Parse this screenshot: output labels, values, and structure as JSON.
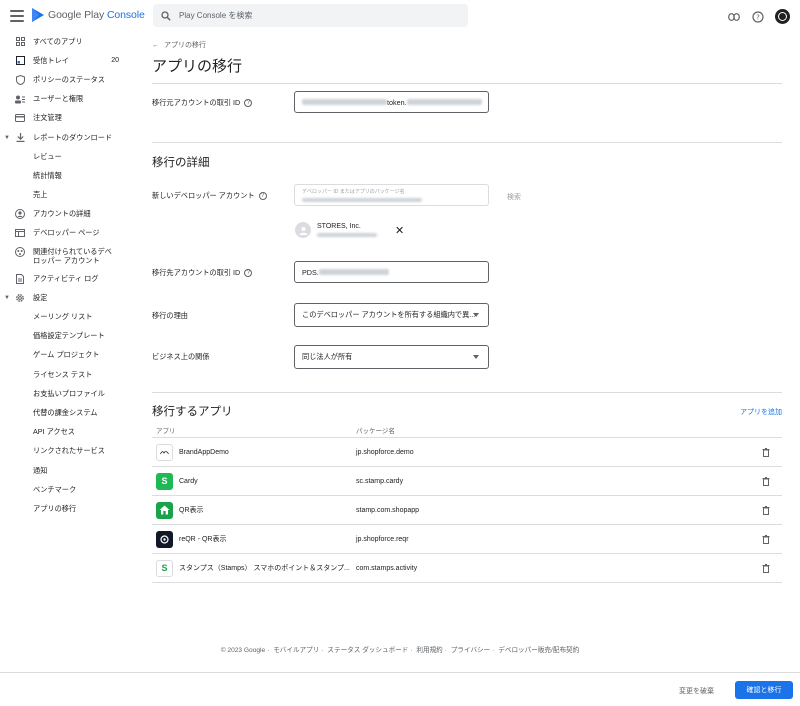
{
  "header": {
    "logo_brand": "Google Play",
    "logo_product": "Console",
    "search_placeholder": "Play Console を検索",
    "icons": [
      "link-icon",
      "help-icon",
      "account-avatar"
    ]
  },
  "sidebar": {
    "items": [
      {
        "label": "すべてのアプリ",
        "icon": "apps-grid-icon"
      },
      {
        "label": "受信トレイ",
        "icon": "inbox-icon",
        "badge": "20"
      },
      {
        "label": "ポリシーのステータス",
        "icon": "shield-icon"
      },
      {
        "label": "ユーザーと権限",
        "icon": "users-icon"
      },
      {
        "label": "注文管理",
        "icon": "card-icon"
      },
      {
        "label": "レポートのダウンロード",
        "icon": "download-icon"
      },
      {
        "label": "レビュー"
      },
      {
        "label": "統計情報"
      },
      {
        "label": "売上"
      },
      {
        "label": "アカウントの詳細",
        "icon": "account-icon"
      },
      {
        "label": "デベロッパー ページ",
        "icon": "page-icon"
      },
      {
        "label": "関連付けられているデベロッパー アカウント",
        "icon": "linked-account-icon"
      },
      {
        "label": "アクティビティ ログ",
        "icon": "log-icon"
      },
      {
        "label": "設定",
        "icon": "gear-icon"
      },
      {
        "label": "メーリング リスト"
      },
      {
        "label": "価格設定テンプレート"
      },
      {
        "label": "ゲーム プロジェクト"
      },
      {
        "label": "ライセンス テスト"
      },
      {
        "label": "お支払いプロファイル"
      },
      {
        "label": "代替の課金システム"
      },
      {
        "label": "API アクセス"
      },
      {
        "label": "リンクされたサービス"
      },
      {
        "label": "通知"
      },
      {
        "label": "ベンチマーク"
      },
      {
        "label": "アプリの移行"
      }
    ]
  },
  "main": {
    "back_label": "アプリの移行",
    "title": "アプリの移行",
    "source_txn_label": "移行元アカウントの取引 ID",
    "source_txn_visible": "token.",
    "details_title": "移行の詳細",
    "new_dev_label": "新しいデベロッパー アカウント",
    "new_dev_placeholder": "デベロッパー ID またはアプリのパッケージ名",
    "search_button": "検索",
    "selected_dev_name": "STORES, Inc.",
    "dest_txn_label": "移行先アカウントの取引 ID",
    "dest_txn_visible": "PDS.",
    "reason_label": "移行の理由",
    "reason_value": "このデベロッパー アカウントを所有する組織内で異...",
    "relationship_label": "ビジネス上の関係",
    "relationship_value": "同じ法人が所有",
    "apps_title": "移行するアプリ",
    "add_app": "アプリを追加",
    "col_app": "アプリ",
    "col_package": "パッケージ名",
    "apps": [
      {
        "name": "BrandAppDemo",
        "package": "jp.shopforce.demo",
        "icon_color": "#ffffff",
        "icon_text": "",
        "icon_border": "#dadce0"
      },
      {
        "name": "Cardy",
        "package": "sc.stamp.cardy",
        "icon_color": "#1db954",
        "icon_text": "S"
      },
      {
        "name": "QR表示",
        "package": "stamp.com.shopapp",
        "icon_color": "#1aa34a",
        "icon_text": "⌂"
      },
      {
        "name": "reQR - QR表示",
        "package": "jp.shopforce.reqr",
        "icon_color": "#111827",
        "icon_text": "◉"
      },
      {
        "name": "スタンプス（Stamps） スマホのポイント＆スタンプ...",
        "package": "com.stamps.activity",
        "icon_color": "#ffffff",
        "icon_text": "S",
        "icon_border": "#dadce0"
      }
    ]
  },
  "footer": {
    "items": [
      "© 2023 Google",
      "モバイルアプリ",
      "ステータス ダッシュボード",
      "利用規約",
      "プライバシー",
      "デベロッパー販売/配布契約"
    ]
  },
  "actions": {
    "discard": "変更を破棄",
    "confirm": "確認と移行"
  },
  "colors": {
    "accent": "#1a73e8"
  }
}
